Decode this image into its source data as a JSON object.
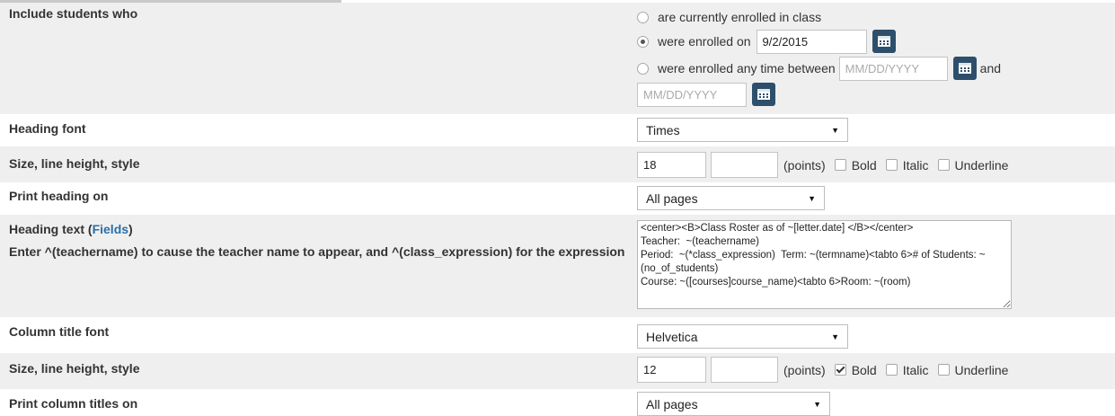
{
  "enrollment": {
    "label": "Include students who",
    "options": [
      {
        "label": "are currently enrolled in class",
        "selected": false
      },
      {
        "label": "were enrolled on",
        "selected": true,
        "date": "9/2/2015"
      },
      {
        "label": "were enrolled any time between",
        "selected": false,
        "from_placeholder": "MM/DD/YYYY",
        "and_label": "and",
        "to_placeholder": "MM/DD/YYYY"
      }
    ],
    "calendar_icon": "calendar-icon"
  },
  "heading_font": {
    "label": "Heading font",
    "value": "Times"
  },
  "heading_size": {
    "label": "Size, line height, style",
    "size": "18",
    "line_height": "",
    "points_label": "(points)",
    "bold_label": "Bold",
    "bold": false,
    "italic_label": "Italic",
    "italic": false,
    "underline_label": "Underline",
    "underline": false
  },
  "print_heading": {
    "label": "Print heading on",
    "value": "All pages"
  },
  "heading_text": {
    "label": "Heading text (",
    "fields_link": "Fields",
    "label_end": ")",
    "description": "Enter ^(teachername) to cause the teacher name to appear, and ^(class_expression) for the expression",
    "value": "<center><B>Class Roster as of ~[letter.date] </B></center>\nTeacher:  ~(teachername)\nPeriod:  ~(*class_expression)  Term: ~(termname)<tabto 6># of Students: ~(no_of_students)\nCourse: ~([courses]course_name)<tabto 6>Room: ~(room)"
  },
  "column_font": {
    "label": "Column title font",
    "value": "Helvetica"
  },
  "column_size": {
    "label": "Size, line height, style",
    "size": "12",
    "line_height": "",
    "points_label": "(points)",
    "bold_label": "Bold",
    "bold": true,
    "italic_label": "Italic",
    "italic": false,
    "underline_label": "Underline",
    "underline": false
  },
  "print_column": {
    "label": "Print column titles on",
    "value": "All pages"
  },
  "colors": {
    "shade": "#efefef",
    "link": "#2a6fa8",
    "calendar_button": "#2d4f6b"
  }
}
